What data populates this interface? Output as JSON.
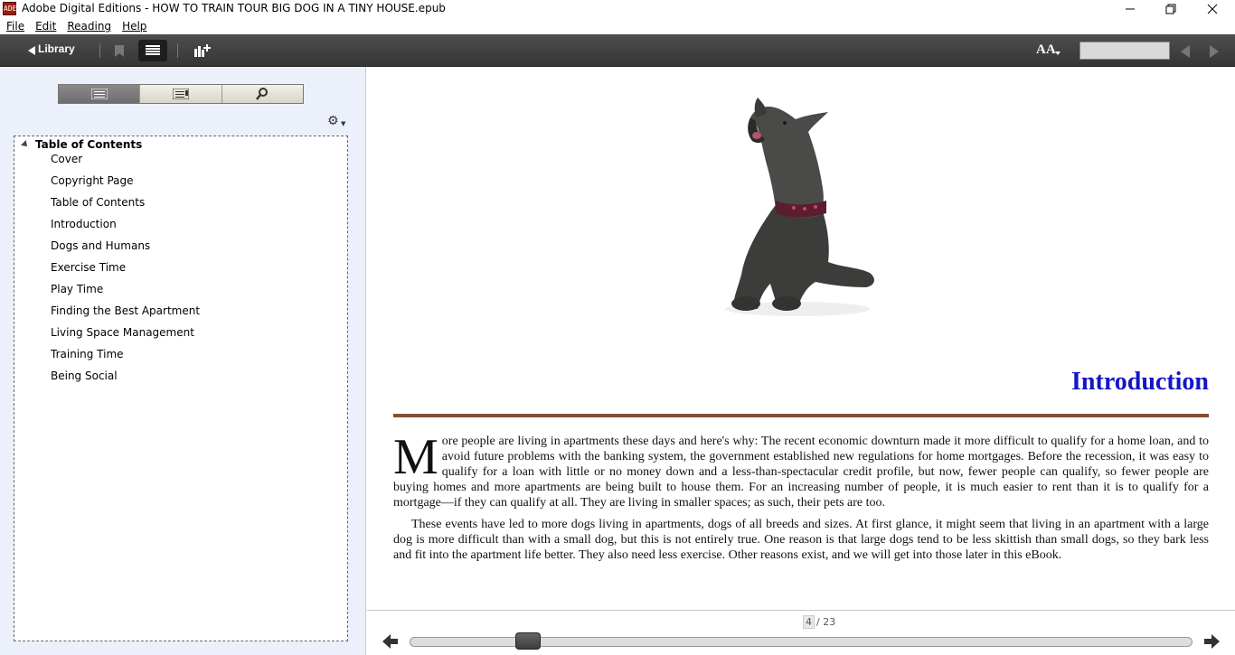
{
  "window": {
    "title": "Adobe Digital Editions - HOW TO TRAIN TOUR BIG DOG IN A TINY HOUSE.epub",
    "app_icon_text": "ADE"
  },
  "menu": [
    {
      "label": "File"
    },
    {
      "label": "Edit"
    },
    {
      "label": "Reading"
    },
    {
      "label": "Help"
    }
  ],
  "toolbar": {
    "library_label": "Library",
    "font_size_label": "AA"
  },
  "toc": {
    "header": "Table of Contents",
    "items": [
      "Cover",
      "Copyright Page",
      "Table of Contents",
      "Introduction",
      "Dogs and Humans",
      "Exercise Time",
      "Play Time",
      "Finding the Best Apartment",
      "Living Space Management",
      "Training Time",
      "Being Social"
    ]
  },
  "content": {
    "chapter_title": "Introduction",
    "dropcap": "M",
    "paragraph1": "ore people are living in apartments these days and here's why: The recent economic downturn made it more difficult to qualify for a home loan, and to avoid future problems with the banking system, the government established new regulations for home mortgages. Before the recession, it was easy to qualify for a loan with little or no money down and a less-than-spectacular credit profile, but now, fewer people can qualify, so fewer people are buying homes and more apartments are being built to house them. For an increasing number of people, it is much easier to rent than it is to qualify for a mortgage—if they can qualify at all. They are living in smaller spaces; as such, their pets are too.",
    "paragraph2": "These events have led to more dogs living in apartments, dogs of all breeds and sizes. At first glance, it might seem that living in an apartment with a large dog is more difficult than with a small dog, but this is not entirely true. One reason is that large dogs tend to be less skittish than small dogs, so they bark less and fit into the apartment life better. They also need less exercise. Other reasons exist, and we will get into those later in this eBook."
  },
  "pagination": {
    "current": "4",
    "total": "/ 23",
    "progress_fraction": 0.14
  },
  "colors": {
    "chapter_title": "#1515c8",
    "rule": "#8a4a33",
    "toolbar": "#424242",
    "sidebar": "#ebf0fa"
  }
}
